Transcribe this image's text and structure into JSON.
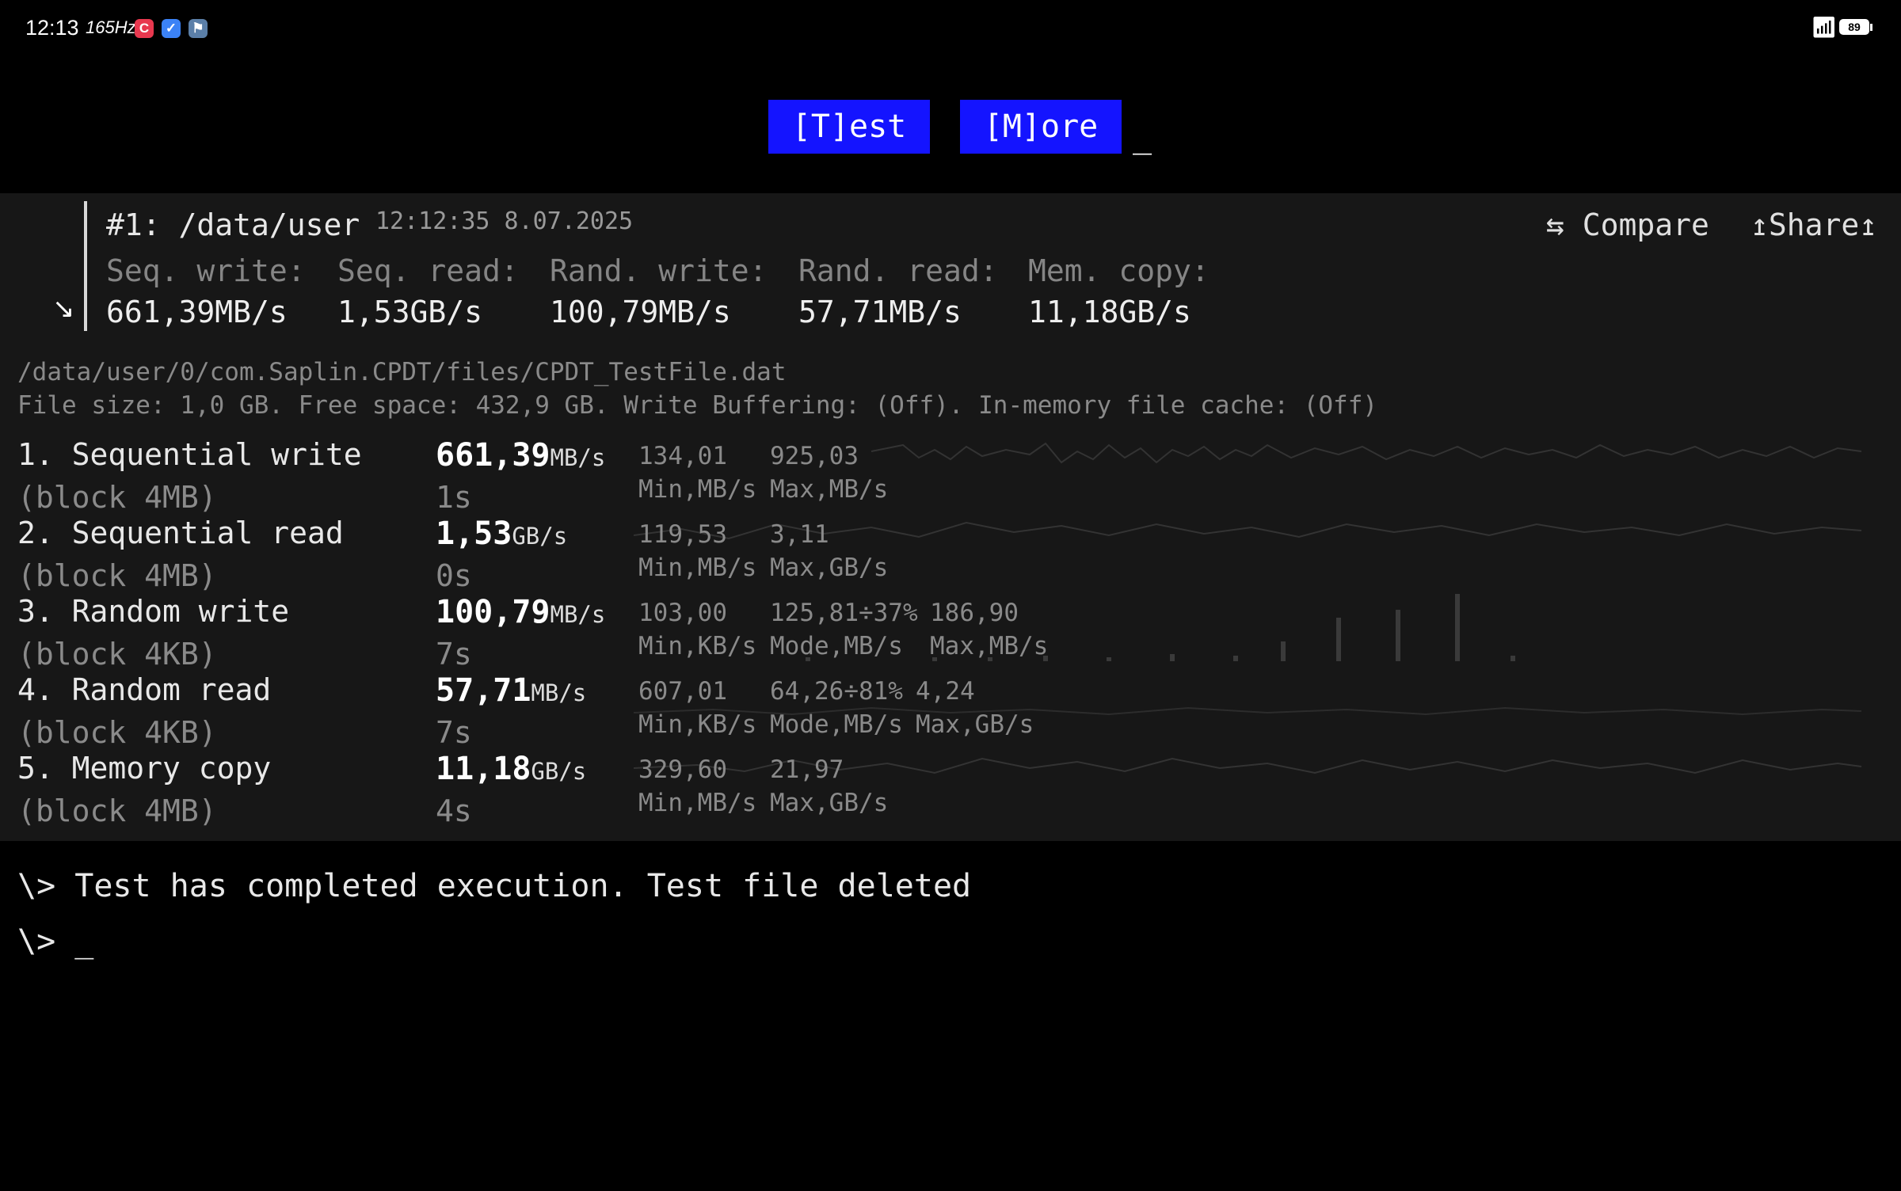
{
  "status_bar": {
    "time": "12:13",
    "refresh": "165Hz",
    "battery": "89",
    "icons": [
      "app-red-icon",
      "checkbox-app-icon",
      "flag-app-icon",
      "wifi-icon",
      "battery-icon"
    ]
  },
  "menu": {
    "test_label": "[T]est",
    "more_label": "[M]ore",
    "cursor": "_"
  },
  "result": {
    "title": "#1: /data/user",
    "timestamp": "12:12:35 8.07.2025",
    "compare_label": "⇆ Compare",
    "share_label": "↥Share↥",
    "summary_labels": [
      "Seq. write:",
      "Seq. read:",
      "Rand. write:",
      "Rand. read:",
      "Mem. copy:"
    ],
    "summary_values": [
      "661,39MB/s",
      "1,53GB/s",
      "100,79MB/s",
      "57,71MB/s",
      "11,18GB/s"
    ]
  },
  "file_path": "/data/user/0/com.Saplin.CPDT/files/CPDT_TestFile.dat",
  "file_info": "File size: 1,0 GB. Free space: 432,9 GB. Write Buffering: (Off). In-memory file cache: (Off)",
  "tests": [
    {
      "name": "1. Sequential write",
      "block": "(block 4MB)",
      "value": "661,39",
      "unit": "MB/s",
      "time": "1s",
      "s1v": "134,01",
      "s1l": "Min,MB/s",
      "s2v": "925,03",
      "s2l": "Max,MB/s",
      "s3v": "",
      "s3l": ""
    },
    {
      "name": "2. Sequential read",
      "block": "(block 4MB)",
      "value": "1,53",
      "unit": "GB/s",
      "time": "0s",
      "s1v": "119,53",
      "s1l": "Min,MB/s",
      "s2v": "3,11",
      "s2l": "Max,GB/s",
      "s3v": "",
      "s3l": ""
    },
    {
      "name": "3. Random write",
      "block": "(block 4KB)",
      "value": "100,79",
      "unit": "MB/s",
      "time": "7s",
      "s1v": "103,00",
      "s1l": "Min,KB/s",
      "s2v": "125,81÷37%",
      "s2l": "Mode,MB/s",
      "s3v": "186,90",
      "s3l": "Max,MB/s"
    },
    {
      "name": "4. Random read",
      "block": "(block 4KB)",
      "value": "57,71",
      "unit": "MB/s",
      "time": "7s",
      "s1v": "607,01",
      "s1l": "Min,KB/s",
      "s2v": "64,26÷81%",
      "s2l": "Mode,MB/s",
      "s3v": "4,24",
      "s3l": "Max,GB/s"
    },
    {
      "name": "5. Memory copy",
      "block": "(block 4MB)",
      "value": "11,18",
      "unit": "GB/s",
      "time": "4s",
      "s1v": "329,60",
      "s1l": "Min,MB/s",
      "s2v": "21,97",
      "s2l": "Max,GB/s",
      "s3v": "",
      "s3l": ""
    }
  ],
  "terminal": {
    "line1": "\\> Test has completed execution. Test file deleted",
    "line2": "\\> _"
  }
}
